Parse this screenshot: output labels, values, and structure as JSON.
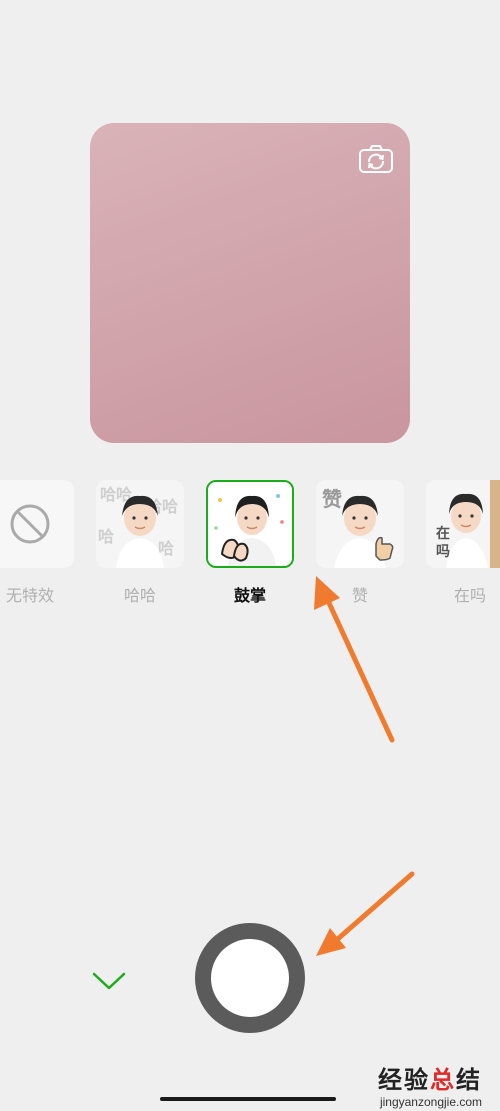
{
  "effects": [
    {
      "label": "无特效",
      "icon": "no-effect-icon",
      "selected": false
    },
    {
      "label": "哈哈",
      "icon": "haha-sticker-thumbnail",
      "selected": false
    },
    {
      "label": "鼓掌",
      "icon": "clapping-sticker-thumbnail",
      "selected": true
    },
    {
      "label": "赞",
      "icon": "thumbs-up-sticker-thumbnail",
      "selected": false
    },
    {
      "label": "在吗",
      "icon": "are-you-there-sticker-thumbnail",
      "selected": false
    }
  ],
  "watermark": {
    "cn_part1": "经验",
    "cn_part2": "总",
    "cn_part3": "结",
    "en": "jingyanzongjie.com"
  },
  "colors": {
    "accent": "#1aad19",
    "annotation_arrow": "#f07b2e",
    "preview": "#d2a7ad"
  }
}
